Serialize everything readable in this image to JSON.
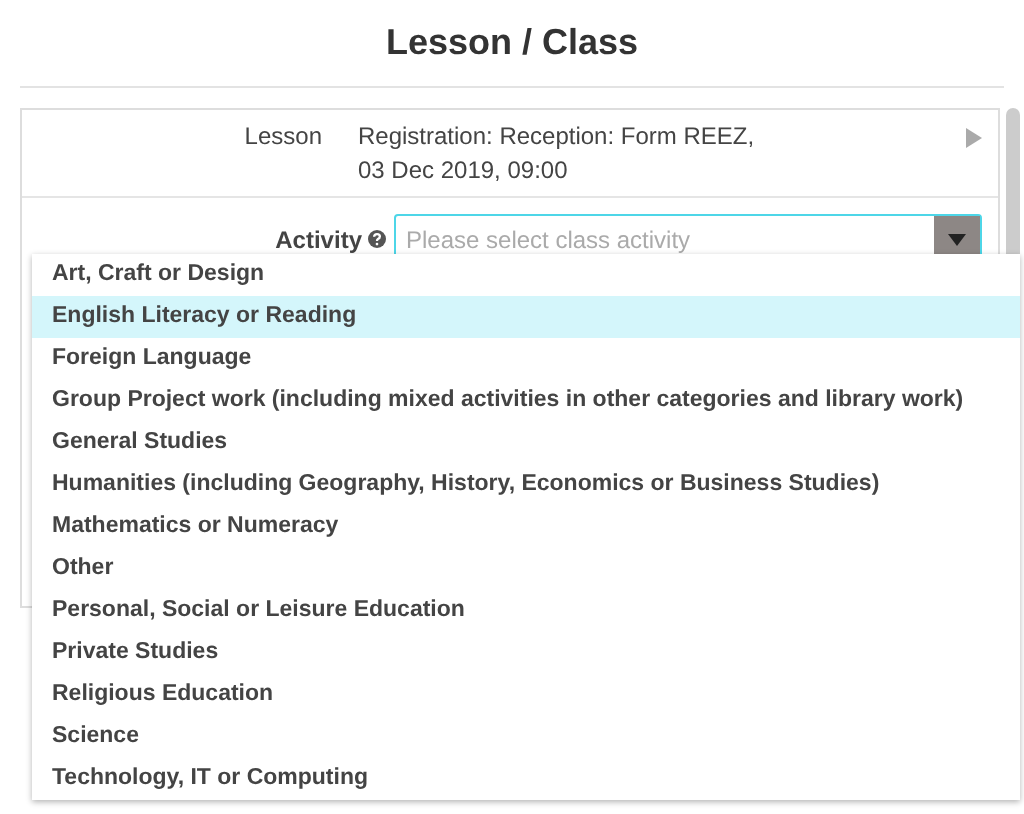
{
  "page": {
    "title": "Lesson / Class"
  },
  "form": {
    "lesson": {
      "label": "Lesson",
      "value_lines": [
        "Registration: Reception: Form REEZ,",
        "03 Dec 2019, 09:00"
      ]
    },
    "activity": {
      "label": "Activity",
      "placeholder": "Please select class activity"
    }
  },
  "dropdown": {
    "options": [
      {
        "label": "Art, Craft or Design",
        "selected": false
      },
      {
        "label": "English Literacy or Reading",
        "selected": true
      },
      {
        "label": "Foreign Language",
        "selected": false
      },
      {
        "label": "Group Project work (including mixed activities in other categories and library work)",
        "selected": false
      },
      {
        "label": "General Studies",
        "selected": false
      },
      {
        "label": "Humanities (including Geography, History, Economics or Business Studies)",
        "selected": false
      },
      {
        "label": "Mathematics or Numeracy",
        "selected": false
      },
      {
        "label": "Other",
        "selected": false
      },
      {
        "label": "Personal, Social or Leisure Education",
        "selected": false
      },
      {
        "label": "Private Studies",
        "selected": false
      },
      {
        "label": "Religious Education",
        "selected": false
      },
      {
        "label": "Science",
        "selected": false
      },
      {
        "label": "Technology, IT or Computing",
        "selected": false
      }
    ]
  }
}
